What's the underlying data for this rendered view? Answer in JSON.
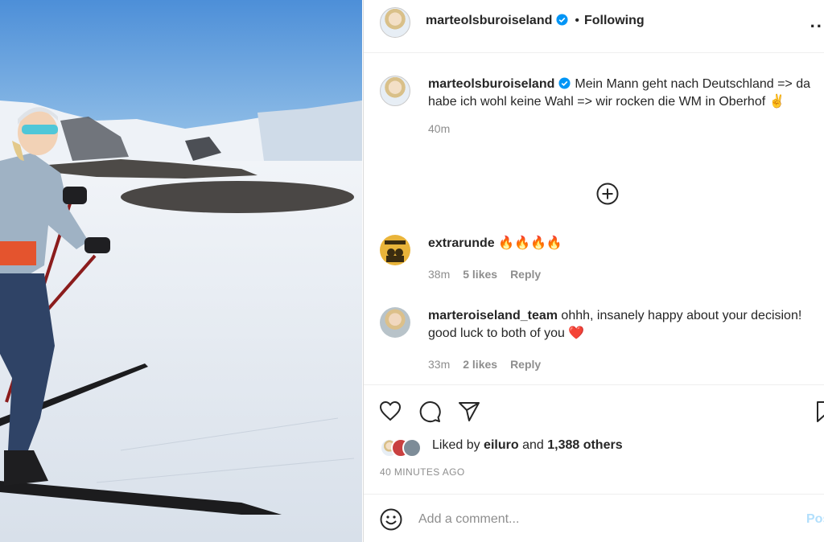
{
  "header": {
    "username": "marteolsburoiseland",
    "dot": "•",
    "follow_status": "Following",
    "more": "..."
  },
  "caption": {
    "username": "marteolsburoiseland",
    "text": "Mein Mann geht nach Deutschland => da habe ich wohl keine Wahl => wir rocken die WM in Oberhof ✌️",
    "time": "40m"
  },
  "comments": [
    {
      "username": "extrarunde",
      "text": "🔥🔥🔥🔥",
      "time": "38m",
      "likes": "5 likes",
      "reply": "Reply"
    },
    {
      "username": "marteroiseland_team",
      "text": "ohhh, insanely happy about your decision! good luck to both of you ❤️",
      "time": "33m",
      "likes": "2 likes",
      "reply": "Reply"
    }
  ],
  "likes": {
    "prefix": "Liked by",
    "user": "eiluro",
    "and": "and",
    "others": "1,388 others"
  },
  "posted": "40 MINUTES AGO",
  "add_comment": {
    "placeholder": "Add a comment...",
    "post": "Post"
  },
  "colors": {
    "verified": "#0095f6",
    "muted": "#8e8e8e",
    "text": "#262626",
    "post_disabled": "#b2dffc"
  }
}
